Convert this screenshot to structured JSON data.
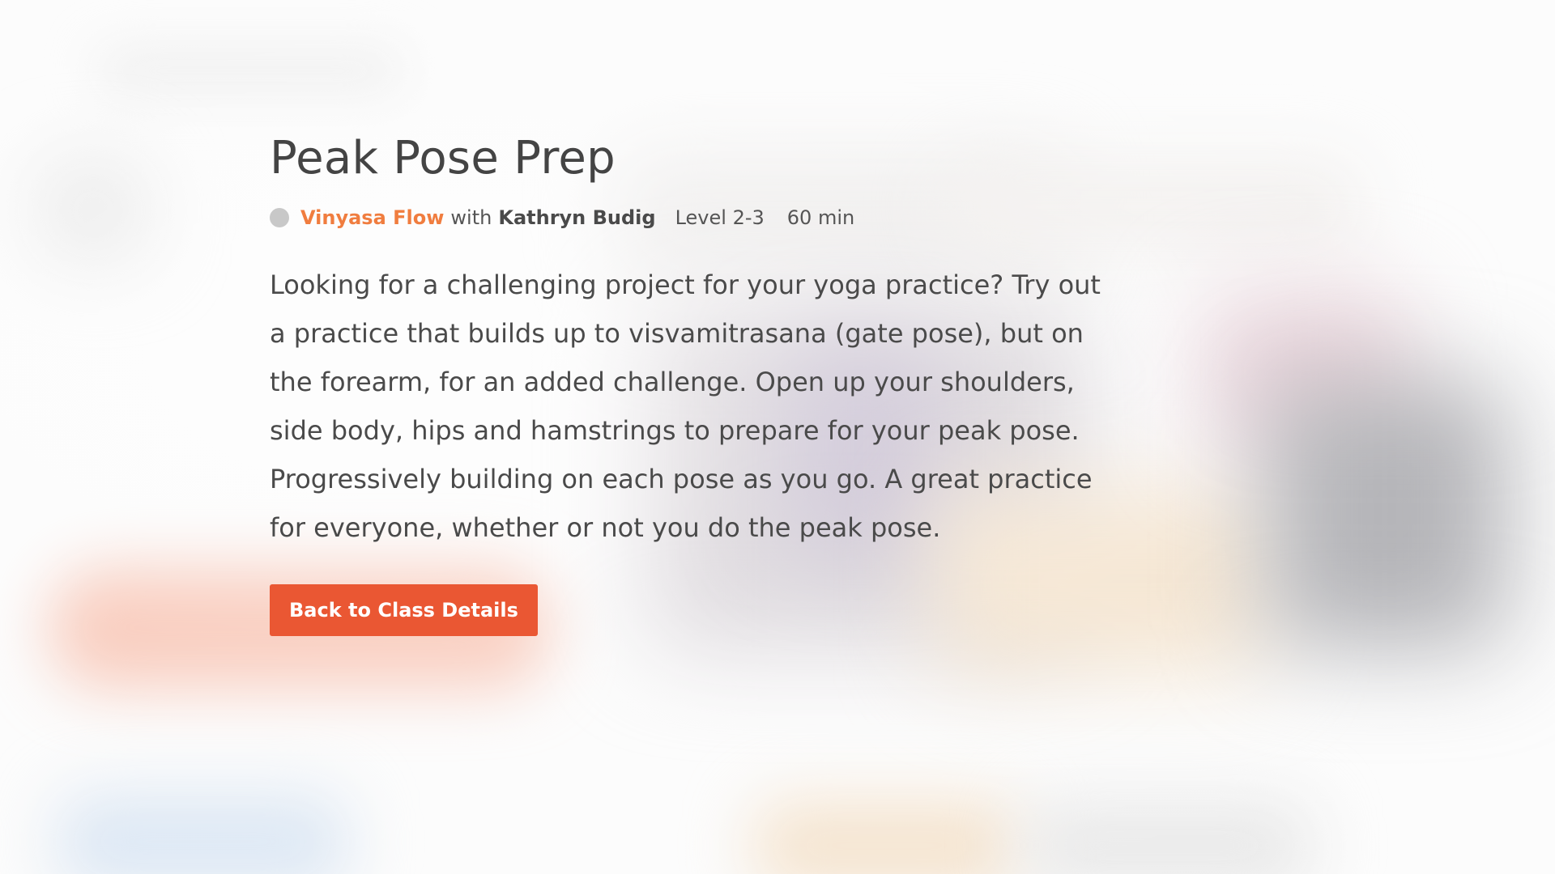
{
  "class": {
    "title": "Peak Pose Prep",
    "style": "Vinyasa Flow",
    "with_text": "with",
    "teacher": "Kathryn Budig",
    "level": "Level 2-3",
    "duration": "60 min",
    "description": "Looking for a challenging project for your yoga practice? Try out a practice that builds up to visvamitrasana (gate pose), but on the forearm, for an added challenge. Open up your shoulders, side body, hips and hamstrings to prepare for your peak pose. Progressively building on each pose as you go. A great practice for everyone, whether or not you do the peak pose."
  },
  "actions": {
    "back_label": "Back to Class Details"
  },
  "colors": {
    "style_accent": "#f07d3f",
    "button_background": "#ea5733",
    "status_dot": "#c8c8c8",
    "text": "#4a4a4a"
  },
  "icons": {
    "meta_dot": "status-dot-icon"
  }
}
